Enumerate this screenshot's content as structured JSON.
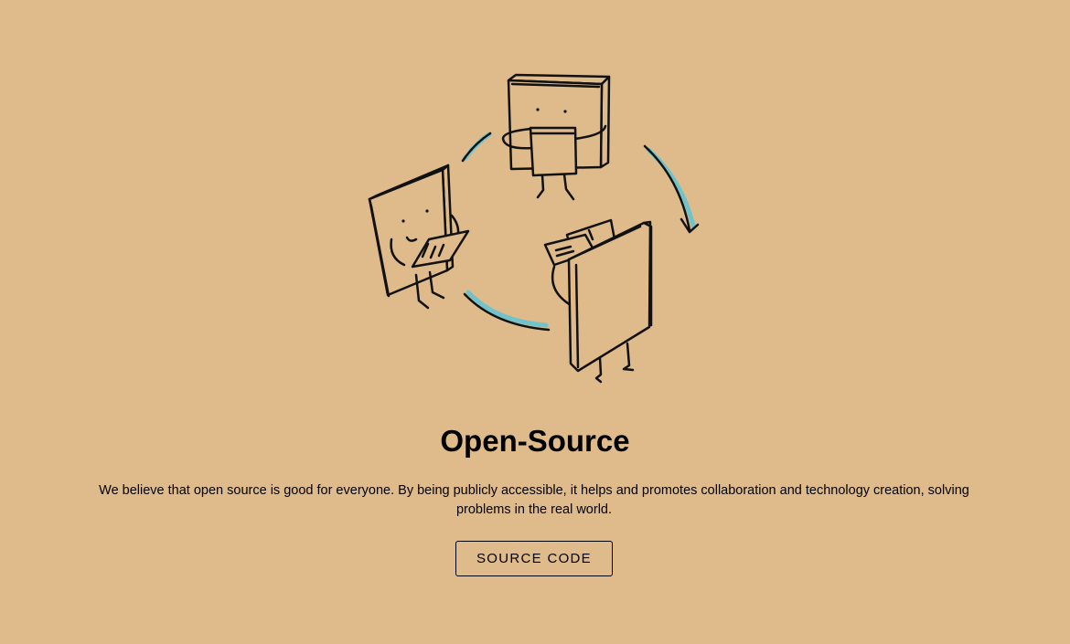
{
  "section": {
    "title": "Open-Source",
    "description": "We believe that open source is good for everyone. By being publicly accessible, it helps and promotes collaboration and technology creation, solving problems in the real world.",
    "button_label": "SOURCE CODE"
  },
  "illustration": {
    "icon": "open-source-cycle-illustration",
    "characters": [
      "book-character-top",
      "book-character-left",
      "book-character-right"
    ],
    "stroke_color": "#111111",
    "accent_color": "#5DC3D6"
  },
  "colors": {
    "background": "#DFBB8B",
    "text": "#000000",
    "button_border": "#000000"
  }
}
